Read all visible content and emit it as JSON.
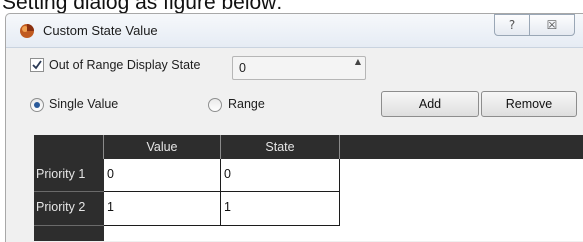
{
  "caption": "Setting dialog as figure below:",
  "dialog": {
    "title": "Custom State Value",
    "help_symbol": "?",
    "close_symbol": "☒"
  },
  "out_of_range": {
    "checked": true,
    "label": "Out of Range Display State",
    "value": "0"
  },
  "mode": {
    "single_label": "Single Value",
    "range_label": "Range",
    "selected": "single"
  },
  "buttons": {
    "add": "Add",
    "remove": "Remove"
  },
  "table": {
    "columns": [
      "Value",
      "State"
    ],
    "rows": [
      {
        "label": "Priority 1",
        "value": "0",
        "state": "0"
      },
      {
        "label": "Priority 2",
        "value": "1",
        "state": "1"
      }
    ]
  },
  "colors": {
    "header_bg": "#2d2d2d",
    "radio_selected": "#2a5a9a"
  }
}
